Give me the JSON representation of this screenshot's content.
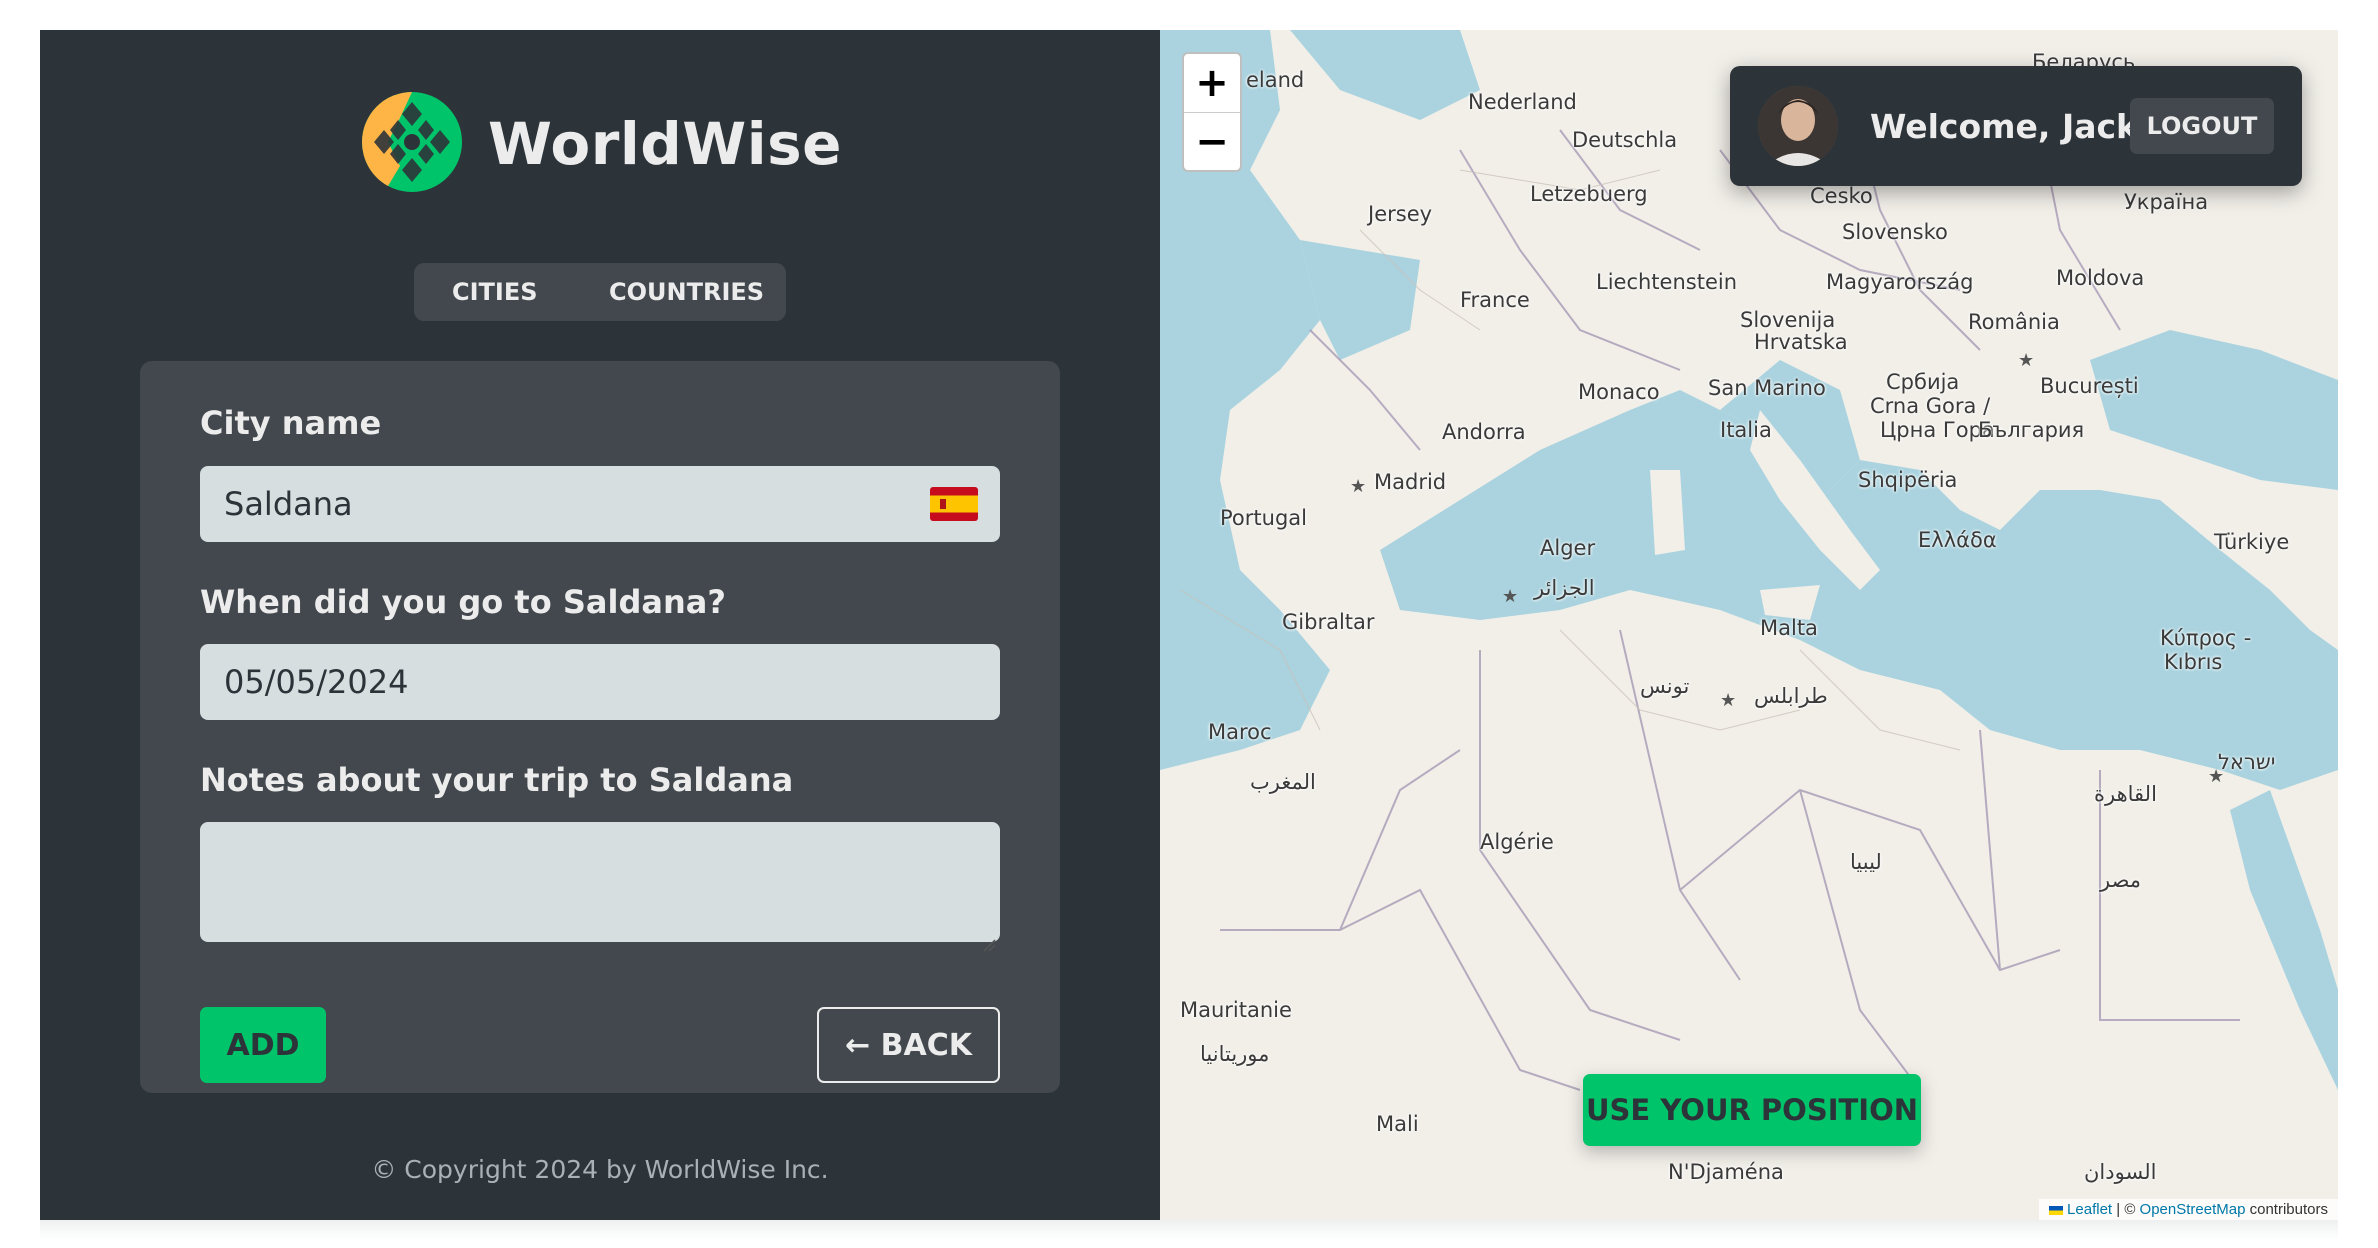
{
  "brand": {
    "name": "WorldWise"
  },
  "tabs": [
    {
      "label": "CITIES"
    },
    {
      "label": "COUNTRIES"
    }
  ],
  "form": {
    "city_label": "City name",
    "city_value": "Saldana",
    "date_label": "When did you go to Saldana?",
    "date_value": "05/05/2024",
    "notes_label": "Notes about your trip to Saldana",
    "notes_value": "",
    "add_label": "ADD",
    "back_label": "← BACK"
  },
  "footer": {
    "copyright": "© Copyright 2024 by WorldWise Inc."
  },
  "map": {
    "zoom_in": "+",
    "zoom_out": "−",
    "use_position_label": "USE YOUR POSITION",
    "attribution": {
      "leaflet": "Leaflet",
      "separator": " | © ",
      "osm": "OpenStreetMap",
      "suffix": " contributors"
    },
    "labels": [
      "Nederland",
      "Deutschla",
      "Letzebuerg",
      "Jersey",
      "France",
      "Liechtenstein",
      "Cesko",
      "Slovensko",
      "Magyarország",
      "Moldova",
      "România",
      "Україна",
      "Беларусь",
      "Slovenija",
      "Hrvatska",
      "Србија",
      "Crna Gora /",
      "Црна Гора",
      "България",
      "București",
      "Monaco",
      "San Marino",
      "Andorra",
      "Italia",
      "Shqipëria",
      "Ελλάδα",
      "Türkiye",
      "Madrid",
      "Portugal",
      "Alger",
      "الجزائر",
      "Gibraltar",
      "Malta",
      "تونس",
      "طرابلس",
      "Κύπρος -",
      "Kıbrıs",
      "ישראל",
      "القاهرة",
      "Maroc",
      "المغرب",
      "Algérie",
      "ليبيا",
      "مصر",
      "Mauritanie",
      "موريتانيا",
      "Mali",
      "N'Djaména",
      "السودان",
      "eland"
    ]
  },
  "user": {
    "welcome": "Welcome, Jack",
    "logout_label": "LOGOUT"
  },
  "colors": {
    "sidebar_bg": "#2d3439",
    "card_bg": "#42484d",
    "accent_green": "#00c46a",
    "text_light": "#ececec",
    "input_bg": "#d6dee0",
    "sea": "#aad3df",
    "land": "#f2efe9"
  },
  "icons": {
    "logo": "worldwise-globe-icon",
    "flag": "spain-flag-icon",
    "resize": "resize-handle-icon"
  }
}
